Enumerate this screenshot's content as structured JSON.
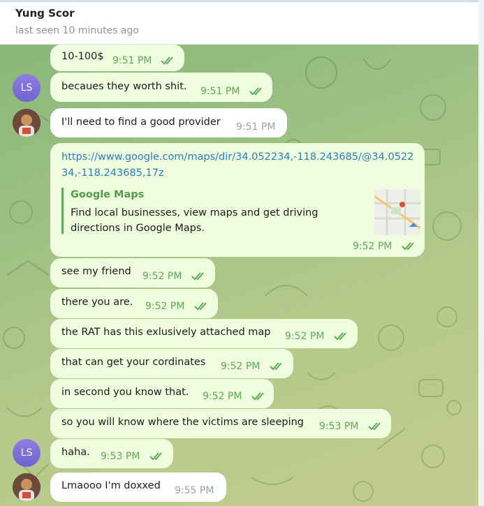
{
  "header": {
    "name": "Yung Scor",
    "status": "last seen 10 minutes ago"
  },
  "messages": [
    {
      "text": "10-100$",
      "time": "9:51 PM"
    },
    {
      "text": "becaues they worth shit.",
      "time": "9:51 PM",
      "avatar": "LS"
    },
    {
      "text": "I'll need to find a good provider",
      "time": "9:51 PM"
    },
    {
      "link": "https://www.google.com/maps/dir/34.052234,-118.243685/@34.052234,-118.243685,17z",
      "preview_title": "Google Maps",
      "preview_desc": "Find local businesses, view maps and get driving directions in Google Maps.",
      "time": "9:52 PM"
    },
    {
      "text": "see my friend",
      "time": "9:52 PM"
    },
    {
      "text": "there you are.",
      "time": "9:52 PM"
    },
    {
      "text": "the RAT has this exlusively attached map",
      "time": "9:52 PM"
    },
    {
      "text": "that can get your cordinates",
      "time": "9:52 PM"
    },
    {
      "text": "in second you know that.",
      "time": "9:52 PM"
    },
    {
      "text": "so you will know where the victims are sleeping",
      "time": "9:53 PM"
    },
    {
      "text": "haha.",
      "time": "9:53 PM",
      "avatar": "LS"
    },
    {
      "text": "Lmaooo I'm doxxed",
      "time": "9:55 PM"
    }
  ],
  "colors": {
    "outgoing_bubble": "#effdde",
    "incoming_bubble": "#ffffff",
    "read_check": "#5cab57",
    "avatar_ls": "#7c6fd9",
    "link": "#2a7fb8"
  },
  "icons": [
    "double-check-icon",
    "avatar-photo-icon",
    "map-thumbnail-icon"
  ]
}
